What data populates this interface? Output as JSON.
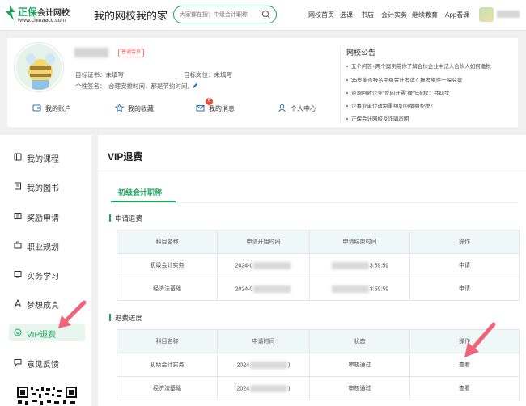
{
  "header": {
    "logo_name": "正保",
    "logo_sub": "会计网校",
    "logo_url": "www.chinaacc.com",
    "slogan": "我的网校我的家",
    "search_placeholder": "大家都在搜：中级会计职称",
    "nav": [
      "网校首页",
      "选课",
      "书店",
      "会计实务",
      "继续教育",
      "App看课"
    ],
    "brand_color": "#1aa35b"
  },
  "profile": {
    "member_badge": "普通会员",
    "target_cert_label": "目标证书：未填写",
    "target_job_label": "目标岗位：未填写",
    "signature_label": "个性签名：",
    "signature_text": "合理安排时间，那是节约时间。",
    "quick_links": [
      {
        "icon": "account-icon",
        "label": "我的账户"
      },
      {
        "icon": "star-icon",
        "label": "我的收藏"
      },
      {
        "icon": "mail-icon",
        "label": "我的消息",
        "badge": "6"
      },
      {
        "icon": "user-icon",
        "label": "个人中心"
      }
    ]
  },
  "notices": {
    "title": "网校公告",
    "items": [
      "五个问答+两个案例带你了解合伙企业中法人合伙人如何缴税",
      "35岁能否报名中级会计考试？报考条件一探究竟",
      "资源回收企业“反向开票”操作流程：共四步",
      "企事业单位改制重组如何缴纳契税？",
      "正保会计网校反诈骗声明"
    ]
  },
  "sidebar": {
    "items": [
      {
        "icon": "course-icon",
        "label": "我的课程"
      },
      {
        "icon": "book-icon",
        "label": "我的图书"
      },
      {
        "icon": "award-icon",
        "label": "奖励申请"
      },
      {
        "icon": "career-icon",
        "label": "职业规划"
      },
      {
        "icon": "practice-icon",
        "label": "实务学习"
      },
      {
        "icon": "rocket-icon",
        "label": "梦想成真"
      },
      {
        "icon": "vip-icon",
        "label": "VIP退费"
      },
      {
        "icon": "feedback-icon",
        "label": "意见反馈"
      }
    ],
    "active_index": 6
  },
  "main": {
    "title": "VIP退费",
    "tab": "初级会计职称",
    "apply_section": {
      "title": "申请退费",
      "headers": [
        "科目名称",
        "申请开始时间",
        "申请结束时间",
        "操作"
      ],
      "rows": [
        {
          "subject": "初级会计实务",
          "start": "2024-0",
          "end_suffix": "3:59:59",
          "action": "申请"
        },
        {
          "subject": "经济法基础",
          "start": "2024-0",
          "end_suffix": "3:59:59",
          "action": "申请"
        }
      ]
    },
    "progress_section": {
      "title": "退费进度",
      "headers": [
        "科目名称",
        "申请时间",
        "状态",
        "操作"
      ],
      "rows": [
        {
          "subject": "初级会计实务",
          "time_prefix": "2024",
          "time_suffix": ")",
          "status": "审核通过",
          "action": "查看"
        },
        {
          "subject": "经济法基础",
          "time_prefix": "2024",
          "time_suffix": ")",
          "status": "审核通过",
          "action": "查看"
        }
      ]
    }
  }
}
